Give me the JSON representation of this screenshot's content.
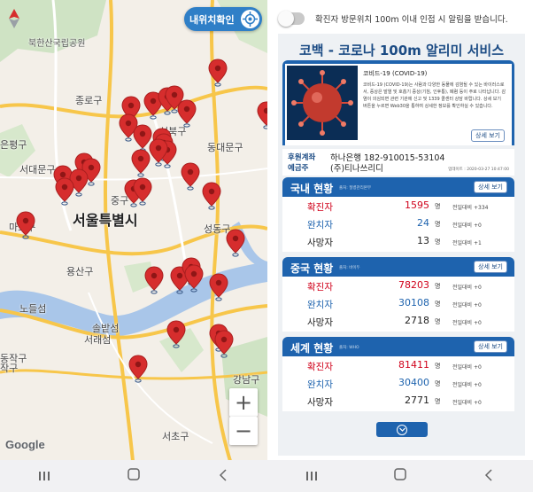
{
  "map": {
    "locate_label": "내위치확인",
    "zoom_in": "+",
    "zoom_out": "−",
    "google": "Google",
    "labels": [
      {
        "name": "label-bukhansan",
        "text": "북한산국립공원"
      },
      {
        "name": "label-jongno",
        "text": "종로구"
      },
      {
        "name": "label-seongbuk",
        "text": "성북구"
      },
      {
        "name": "label-dongdaemun",
        "text": "동대문구"
      },
      {
        "name": "label-eunpyeong",
        "text": "은평구"
      },
      {
        "name": "label-seodaemun",
        "text": "서대문구"
      },
      {
        "name": "label-mapo",
        "text": "마포구"
      },
      {
        "name": "label-jung",
        "text": "중구"
      },
      {
        "name": "label-seoul",
        "text": "서울특별시"
      },
      {
        "name": "label-seongdong",
        "text": "성동구"
      },
      {
        "name": "label-yongsan",
        "text": "용산구"
      },
      {
        "name": "label-nodeulseom",
        "text": "노들섬"
      },
      {
        "name": "label-solbat",
        "text": "솔밭섬"
      },
      {
        "name": "label-seorae",
        "text": "서래섬"
      },
      {
        "name": "label-gangnam",
        "text": "강남구"
      },
      {
        "name": "label-dongjak",
        "text": "동작구"
      },
      {
        "name": "label-seocho",
        "text": "서초구"
      },
      {
        "name": "label-jakgu",
        "text": "작구"
      }
    ]
  },
  "notify": {
    "text": "확진자 방문위치 100m 이내 인접 시 알림을 받습니다."
  },
  "service_title": "코백 - 코로나 100m 알리미 서비스",
  "virus_info": {
    "title": "코비드-19 (COVID-19)",
    "desc": "코비드-19 (COVID-19)는 사람과 다양한 동물에 감염될 수 있는 바이러스로서, 증상은 발열 및 호흡기 증상(기침, 인후통), 폐렴 등이 주로 나타납니다. 감염이 의심되면 관련 기관에 신고 및 1339 콜센터 상담 바랍니다. 상세 보기 버튼을 누르면 Web30을 통하여 상세한 정보를 확인하실 수 있습니다.",
    "more": "상세 보기"
  },
  "sponsor": {
    "label1": "후원계좌",
    "label2": "예금주",
    "account": "하나은행 182-910015-53104",
    "holder": "(주)티나쓰리디",
    "updated": "업데이트 : 2020-03-27 10:47:00"
  },
  "stats": [
    {
      "title": "국내 현황",
      "source": "출처: 질병관리본부",
      "more": "상세 보기",
      "rows": [
        {
          "label": "확진자",
          "value": "1595",
          "unit": "명",
          "delta": "전일대비 +334",
          "color": "#d0021b"
        },
        {
          "label": "완치자",
          "value": "24",
          "unit": "명",
          "delta": "전일대비 +0",
          "color": "#1e63ae"
        },
        {
          "label": "사망자",
          "value": "13",
          "unit": "명",
          "delta": "전일대비 +1",
          "color": "#222222"
        }
      ]
    },
    {
      "title": "중국 현황",
      "source": "출처: 바이두",
      "more": "상세 보기",
      "rows": [
        {
          "label": "확진자",
          "value": "78203",
          "unit": "명",
          "delta": "전일대비 +0",
          "color": "#d0021b"
        },
        {
          "label": "완치자",
          "value": "30108",
          "unit": "명",
          "delta": "전일대비 +0",
          "color": "#1e63ae"
        },
        {
          "label": "사망자",
          "value": "2718",
          "unit": "명",
          "delta": "전일대비 +0",
          "color": "#222222"
        }
      ]
    },
    {
      "title": "세계 현황",
      "source": "출처: WHO",
      "more": "상세 보기",
      "rows": [
        {
          "label": "확진자",
          "value": "81411",
          "unit": "명",
          "delta": "전일대비 +0",
          "color": "#d0021b"
        },
        {
          "label": "완치자",
          "value": "30400",
          "unit": "명",
          "delta": "전일대비 +0",
          "color": "#1e63ae"
        },
        {
          "label": "사망자",
          "value": "2771",
          "unit": "명",
          "delta": "전일대비 +0",
          "color": "#222222"
        }
      ]
    }
  ],
  "colors": {
    "primary": "#1e63ae",
    "pin": "#d62d2d",
    "river": "#a9c6e9",
    "road": "#f7c64a"
  },
  "icons": [
    "compass-icon",
    "target-icon",
    "map-pin-icon",
    "chevron-down-icon",
    "nav-recents-icon",
    "nav-home-icon",
    "nav-back-icon"
  ]
}
